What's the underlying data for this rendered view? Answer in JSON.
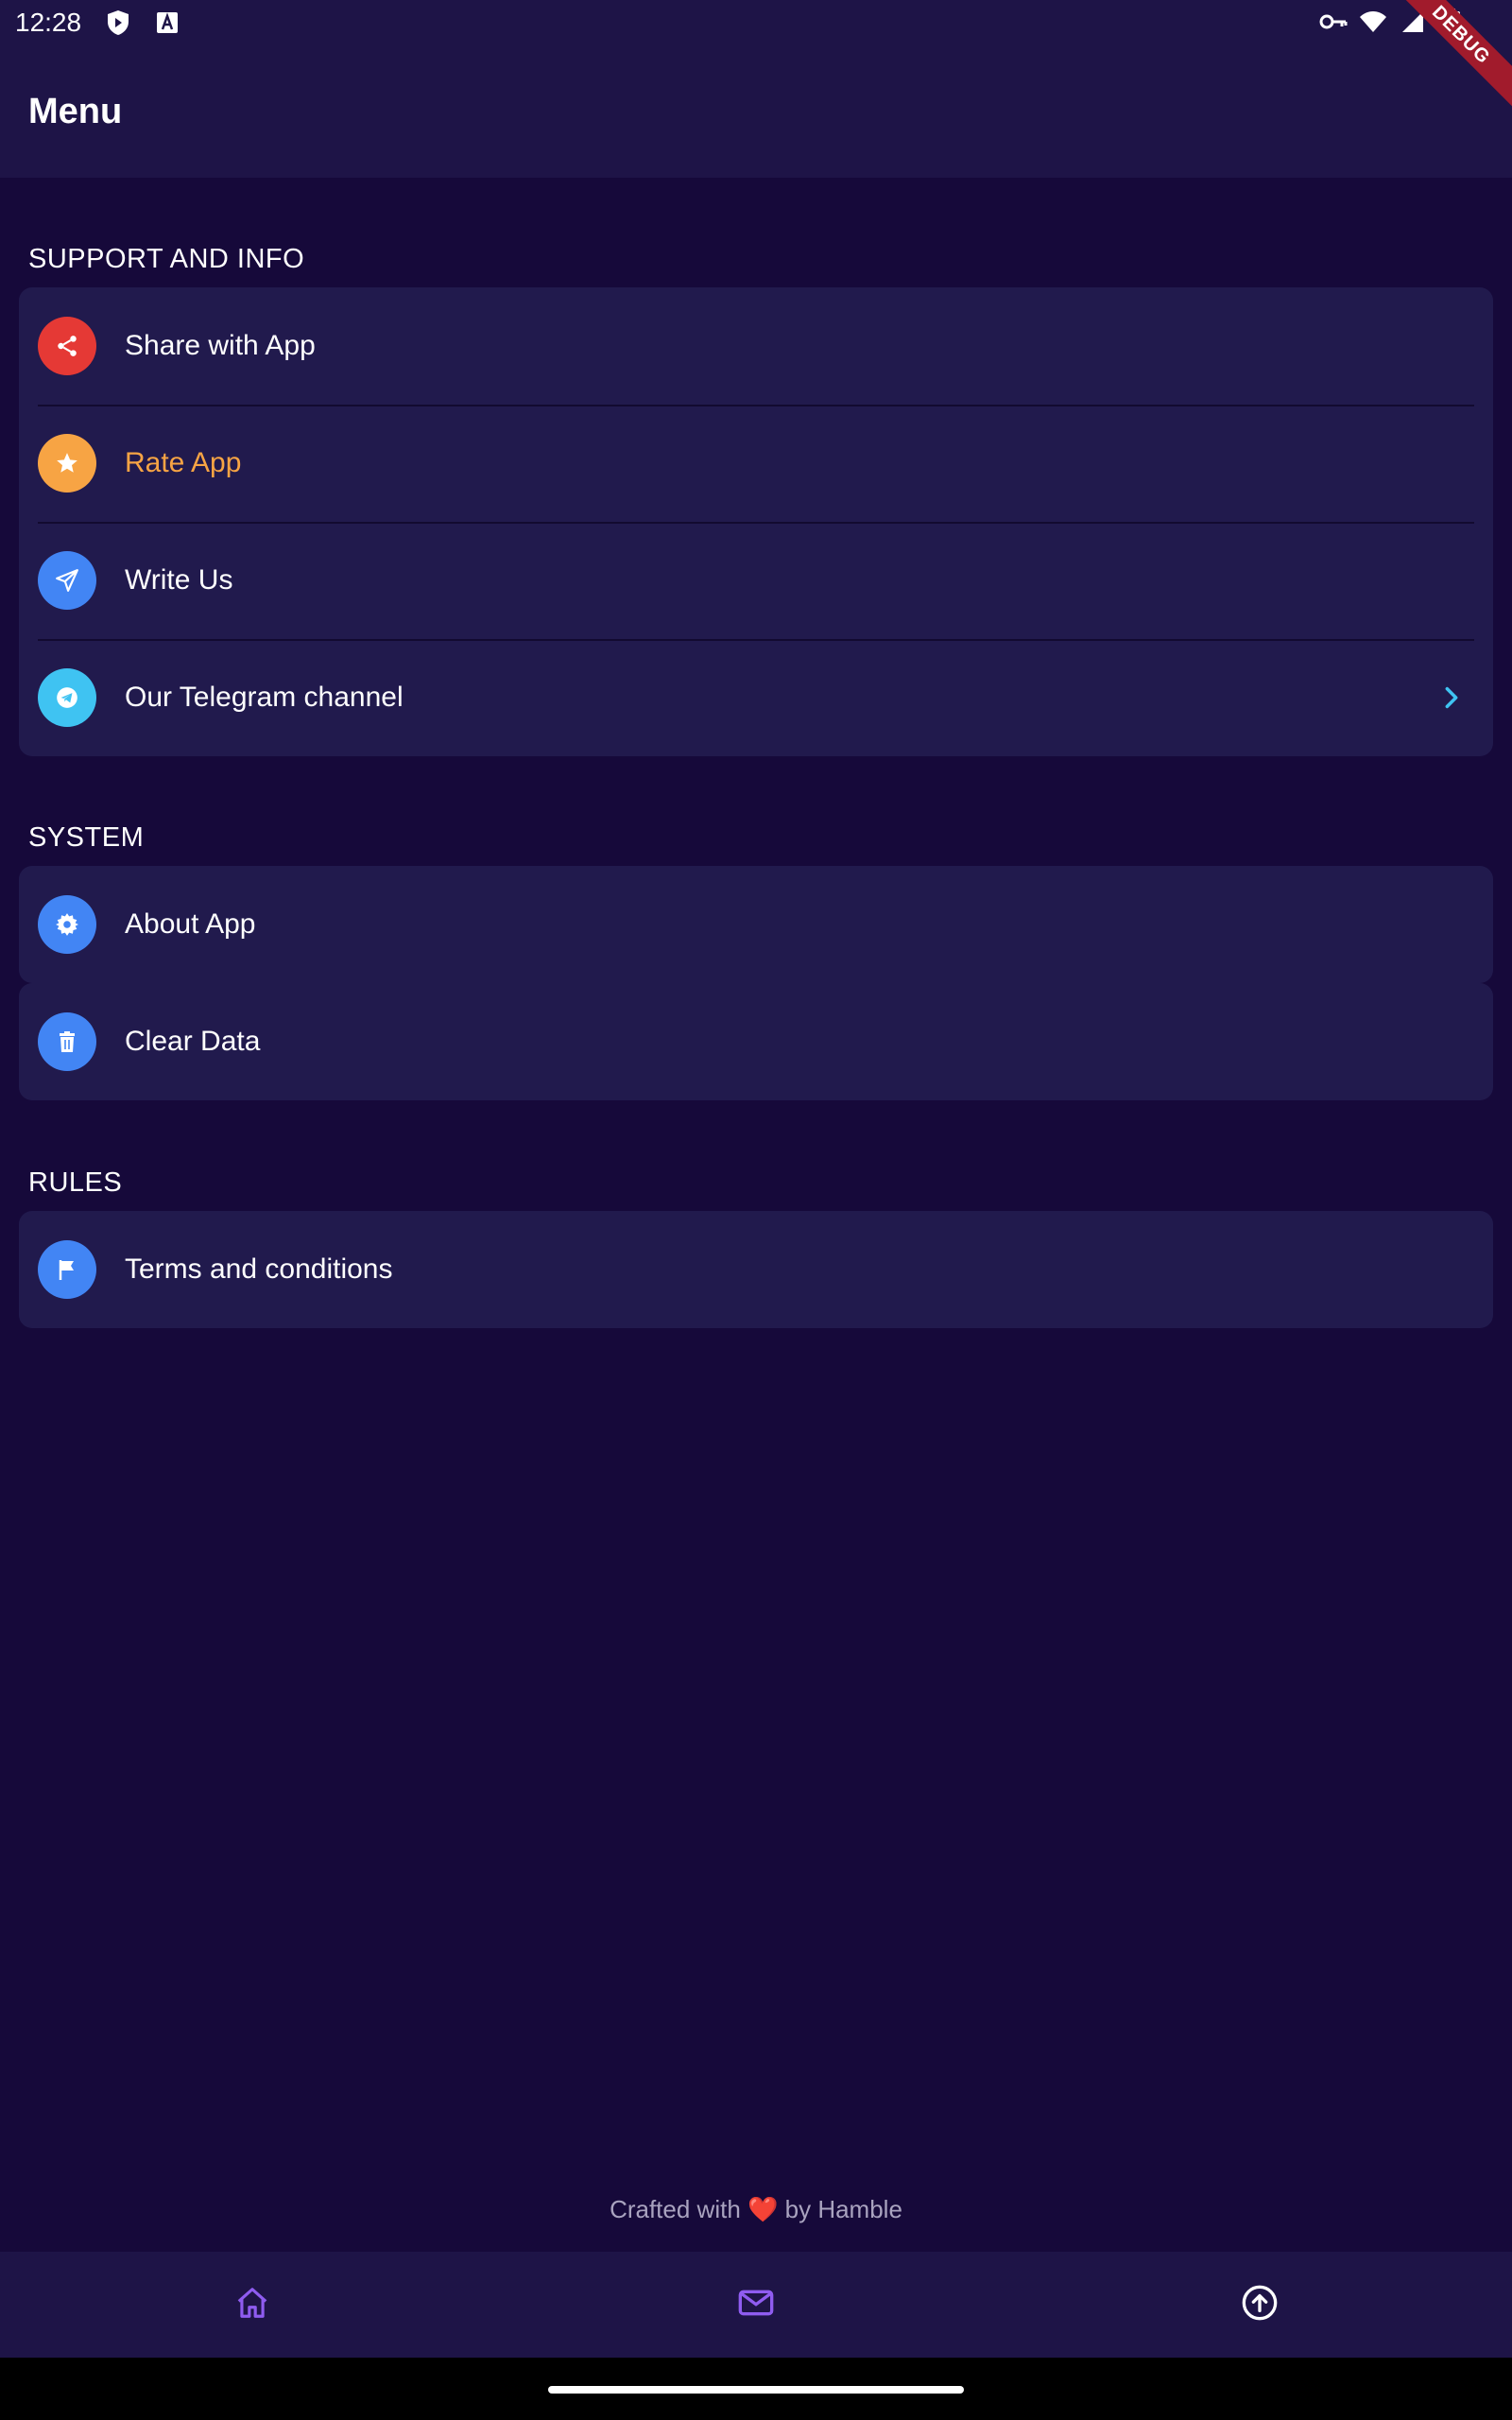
{
  "status_bar": {
    "time": "12:28"
  },
  "debug_banner": "DEBUG",
  "app_bar": {
    "title": "Menu"
  },
  "sections": [
    {
      "header": "SUPPORT AND INFO",
      "items": [
        {
          "label": "Share with App",
          "icon": "share-icon",
          "icon_color": "#e53935"
        },
        {
          "label": "Rate App",
          "icon": "star-icon",
          "icon_color": "#f7a444",
          "label_color": "#f7a444"
        },
        {
          "label": "Write Us",
          "icon": "send-icon",
          "icon_color": "#4285f4"
        },
        {
          "label": "Our Telegram channel",
          "icon": "telegram-icon",
          "icon_color": "#3fc3f2",
          "has_chevron": true
        }
      ]
    },
    {
      "header": "SYSTEM",
      "items": [
        {
          "label": "About App",
          "icon": "gear-icon",
          "icon_color": "#4285f4"
        },
        {
          "label": "Clear Data",
          "icon": "trash-icon",
          "icon_color": "#4285f4"
        }
      ]
    },
    {
      "header": "RULES",
      "items": [
        {
          "label": "Terms and conditions",
          "icon": "flag-icon",
          "icon_color": "#4285f4"
        }
      ]
    }
  ],
  "footer": {
    "prefix": "Crafted with",
    "heart": "❤️",
    "suffix": "by Hamble"
  },
  "bottom_nav": {
    "items": [
      {
        "icon": "home-icon",
        "color": "#8f5cf0"
      },
      {
        "icon": "mail-icon",
        "color": "#8f5cf0"
      },
      {
        "icon": "upload-circle-icon",
        "color": "#ffffff"
      }
    ]
  },
  "colors": {
    "background": "#16093a",
    "surface": "#211a4d",
    "bar": "#1e1447",
    "accent_purple": "#8f5cf0",
    "chevron": "#3fc3f2"
  }
}
